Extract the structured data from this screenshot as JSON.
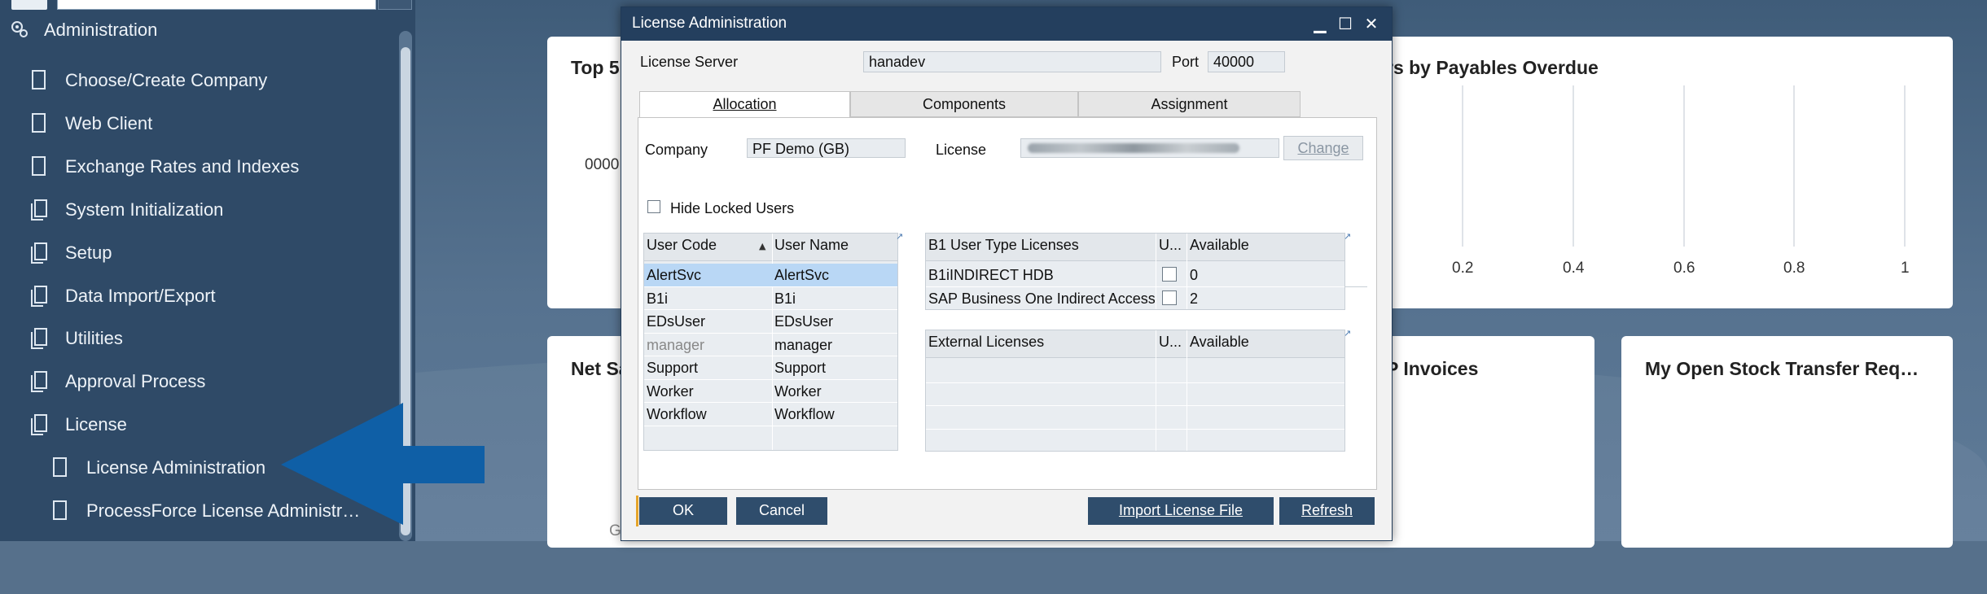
{
  "sidebar": {
    "header_label": "Administration",
    "items": [
      {
        "label": "Choose/Create Company",
        "icon": "page-icon"
      },
      {
        "label": "Web Client",
        "icon": "page-icon"
      },
      {
        "label": "Exchange Rates and Indexes",
        "icon": "page-icon"
      },
      {
        "label": "System Initialization",
        "icon": "folder-icon"
      },
      {
        "label": "Setup",
        "icon": "folder-icon"
      },
      {
        "label": "Data Import/Export",
        "icon": "folder-icon"
      },
      {
        "label": "Utilities",
        "icon": "folder-icon"
      },
      {
        "label": "Approval Process",
        "icon": "folder-icon"
      },
      {
        "label": "License",
        "icon": "folder-open-icon"
      }
    ],
    "sub_items": [
      {
        "label": "License Administration",
        "icon": "page-icon"
      },
      {
        "label": "ProcessForce License Administr…",
        "icon": "page-icon"
      }
    ]
  },
  "dashboard": {
    "card1_title": "Top 5",
    "card1_value": "0000",
    "card2_title": "rs by Payables Overdue",
    "card2_axis": [
      "0.2",
      "0.4",
      "0.6",
      "0.8",
      "1"
    ],
    "card3_title": "Net Sa",
    "card3_footer": "G",
    "card4_title": "P Invoices",
    "card5_title": "My Open Stock Transfer Req…"
  },
  "dialog": {
    "title": "License Administration",
    "window_controls": {
      "minimize": "▁",
      "maximize": "☐",
      "close": "✕"
    },
    "license_server_label": "License Server",
    "license_server_value": "hanadev",
    "port_label": "Port",
    "port_value": "40000",
    "tabs": [
      {
        "label": "Allocation",
        "active": true
      },
      {
        "label": "Components",
        "active": false
      },
      {
        "label": "Assignment",
        "active": false
      }
    ],
    "company_label": "Company",
    "company_value": "PF Demo (GB)",
    "license_label": "License",
    "license_value": "",
    "change_button": "Change",
    "hide_locked_label": "Hide Locked Users",
    "users_grid": {
      "columns": [
        "User Code",
        "User Name"
      ],
      "rows": [
        {
          "code": "AlertSvc",
          "name": "AlertSvc",
          "selected": true
        },
        {
          "code": "B1i",
          "name": "B1i"
        },
        {
          "code": "EDsUser",
          "name": "EDsUser"
        },
        {
          "code": "manager",
          "name": "manager",
          "dimmed": true
        },
        {
          "code": "Support",
          "name": "Support"
        },
        {
          "code": "Worker",
          "name": "Worker"
        },
        {
          "code": "Workflow",
          "name": "Workflow"
        }
      ]
    },
    "b1_grid": {
      "columns": [
        "B1 User Type Licenses",
        "U...",
        "Available"
      ],
      "rows": [
        {
          "type": "B1iINDIRECT HDB",
          "available": "0"
        },
        {
          "type": "SAP Business One Indirect Access U",
          "available": "2"
        }
      ]
    },
    "ext_grid": {
      "columns": [
        "External Licenses",
        "U...",
        "Available"
      ]
    },
    "buttons": {
      "ok": "OK",
      "cancel": "Cancel",
      "import": "Import License File",
      "refresh": "Refresh"
    }
  },
  "colors": {
    "sidebar_bg": "#2f4a67",
    "dialog_title_bg": "#243f5e",
    "button_bg": "#2f4d6c",
    "selected_row": "#b9d7f5",
    "arrow": "#0f5fa6"
  }
}
